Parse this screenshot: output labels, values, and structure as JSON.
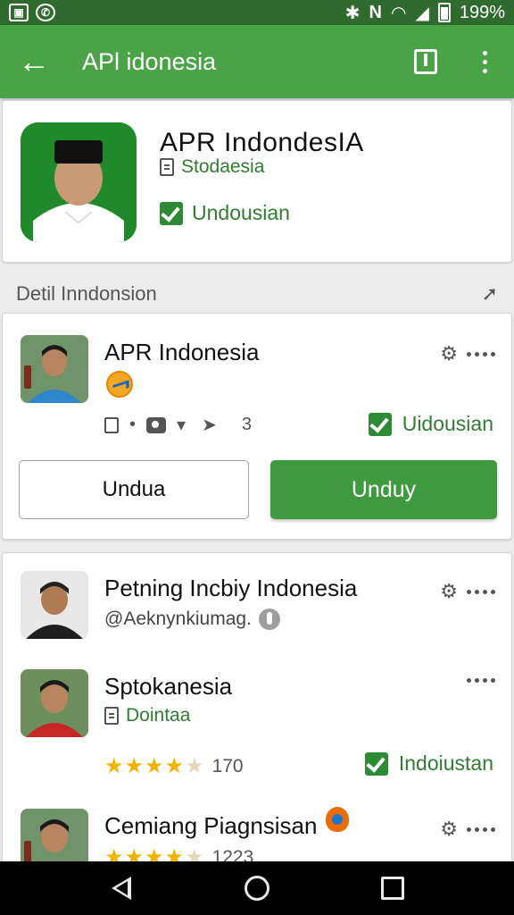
{
  "status_bar": {
    "battery_percent": "199%",
    "icons": [
      "gallery-icon",
      "whatsapp-icon",
      "bluetooth-icon",
      "nfc-icon",
      "wifi-icon",
      "signal-icon",
      "battery-icon"
    ]
  },
  "app_bar": {
    "title": "APl idonesia",
    "icons": [
      "back-arrow-icon",
      "bookmark-icon",
      "more-vert-icon"
    ]
  },
  "hero": {
    "name": "APR IndondesIA",
    "subtitle": "Stodaesia",
    "badge": "Undousian",
    "icon_bg": "#1f8a2a"
  },
  "section": {
    "title": "Detil Inndonsion"
  },
  "detail": {
    "name": "APR Indonesia",
    "meta_count": "3",
    "status": "Uidousian",
    "button_secondary": "Undua",
    "button_primary": "Unduy"
  },
  "list": {
    "items": [
      {
        "title": "Petning Incbiy Indonesia",
        "subtitle": "@Aeknynkiumag."
      },
      {
        "title": "Sptokanesia",
        "subtitle": "Dointaa",
        "rating_count": "170",
        "rating": 4.5,
        "status": "Indoiustan"
      },
      {
        "title": "Cemiang Piagnsisan",
        "rating_count": "1223",
        "rating": 4.5
      }
    ]
  },
  "nav_bar": {
    "icons": [
      "nav-back-icon",
      "nav-home-icon",
      "nav-recents-icon"
    ]
  },
  "colors": {
    "status_bar": "#2f6b2f",
    "app_bar": "#4aa346",
    "accent_green": "#2e7d32",
    "button_green": "#3f9a3f",
    "star": "#f0b400"
  }
}
